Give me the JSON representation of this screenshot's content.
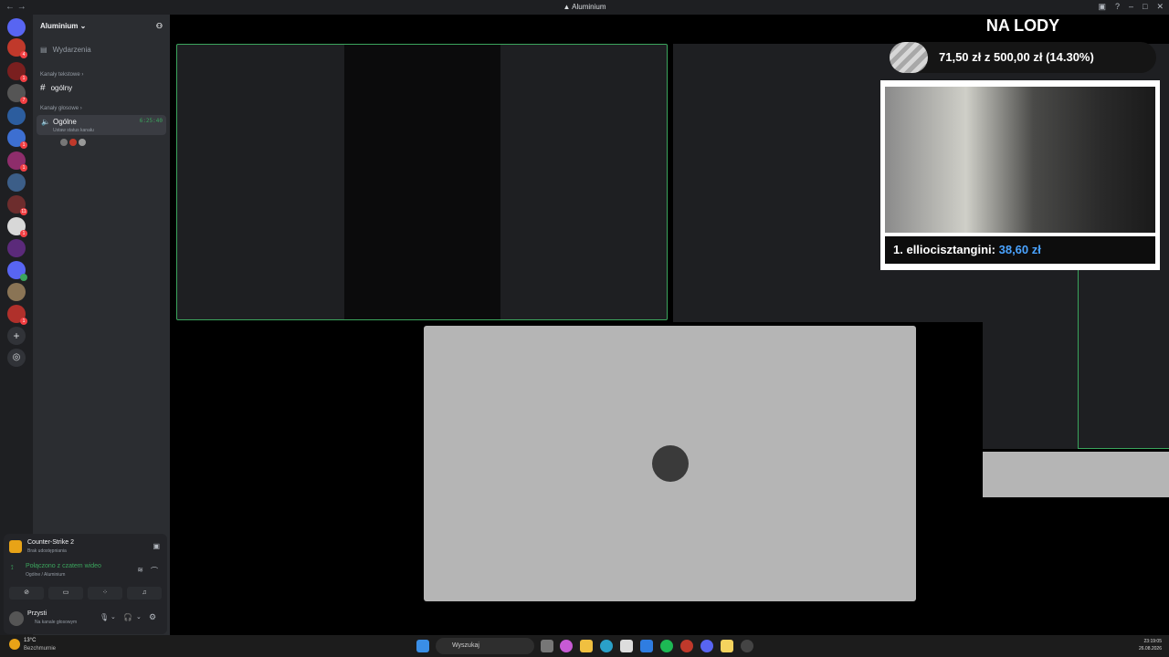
{
  "window": {
    "title": "Aluminium"
  },
  "server": {
    "name": "Aluminium",
    "events_label": "Wydarzenia"
  },
  "categories": {
    "text": "Kanały tekstowe",
    "voice": "Kanały głosowe"
  },
  "text_channel": {
    "name": "ogólny"
  },
  "voice_channel": {
    "name": "Ogólne",
    "timer": "6:25:40",
    "status_placeholder": "Ustaw status kanału"
  },
  "activity": {
    "game": "Counter-Strike 2",
    "sub": "Brak udostępniania"
  },
  "connection": {
    "status": "Połączono z czatem wideo",
    "location": "Ogólne / Aluminium"
  },
  "user": {
    "name": "Przysti",
    "status": "Na kanale głosowym"
  },
  "overlay": {
    "title": "NA LODY",
    "goal_text": "71,50 zł z 500,00 zł (14.30%)",
    "top_donor_rank": "1.",
    "top_donor_name": "elliocisztangini:",
    "top_donor_amount": "38,60 zł"
  },
  "taskbar": {
    "search_placeholder": "Wyszukaj",
    "weather_temp": "13°C",
    "weather_desc": "Bezchmurnie",
    "time": "23:19:05",
    "date": "26.08.2026"
  },
  "colors": {
    "accent_green": "#3ba55d",
    "donor_amount": "#4aa3ff"
  }
}
